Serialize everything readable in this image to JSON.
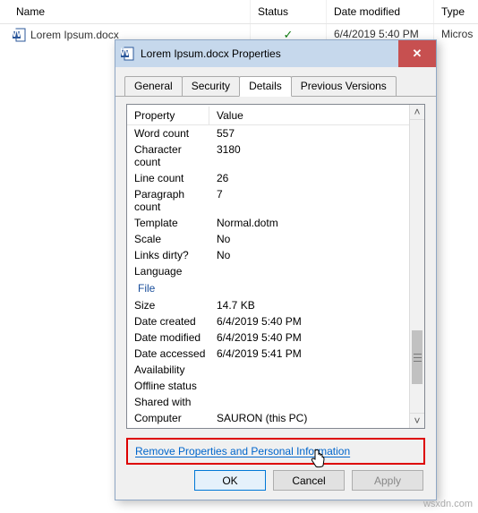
{
  "explorer": {
    "columns": {
      "name": "Name",
      "status": "Status",
      "modified": "Date modified",
      "type": "Type"
    },
    "file": {
      "name": "Lorem Ipsum.docx",
      "status_icon": "check-circle",
      "modified": "6/4/2019 5:40 PM",
      "type": "Micros"
    }
  },
  "dialog": {
    "title": "Lorem Ipsum.docx Properties",
    "tabs": {
      "general": "General",
      "security": "Security",
      "details": "Details",
      "previous": "Previous Versions"
    },
    "columns": {
      "property": "Property",
      "value": "Value"
    },
    "rows": {
      "word_count": {
        "label": "Word count",
        "value": "557"
      },
      "char_count": {
        "label": "Character count",
        "value": "3180"
      },
      "line_count": {
        "label": "Line count",
        "value": "26"
      },
      "para_count": {
        "label": "Paragraph count",
        "value": "7"
      },
      "template": {
        "label": "Template",
        "value": "Normal.dotm"
      },
      "scale": {
        "label": "Scale",
        "value": "No"
      },
      "links_dirty": {
        "label": "Links dirty?",
        "value": "No"
      },
      "language": {
        "label": "Language",
        "value": ""
      }
    },
    "section": {
      "file": "File"
    },
    "file_rows": {
      "size": {
        "label": "Size",
        "value": "14.7 KB"
      },
      "date_created": {
        "label": "Date created",
        "value": "6/4/2019 5:40 PM"
      },
      "date_modified": {
        "label": "Date modified",
        "value": "6/4/2019 5:40 PM"
      },
      "date_accessed": {
        "label": "Date accessed",
        "value": "6/4/2019 5:41 PM"
      },
      "availability": {
        "label": "Availability",
        "value": ""
      },
      "offline_status": {
        "label": "Offline status",
        "value": ""
      },
      "shared_with": {
        "label": "Shared with",
        "value": ""
      },
      "computer": {
        "label": "Computer",
        "value": "SAURON (this PC)"
      }
    },
    "link": "Remove Properties and Personal Information",
    "buttons": {
      "ok": "OK",
      "cancel": "Cancel",
      "apply": "Apply"
    }
  },
  "watermark": "wsxdn.com"
}
